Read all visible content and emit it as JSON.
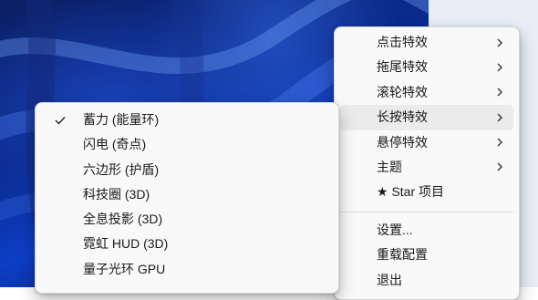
{
  "main_menu": {
    "items": [
      {
        "label": "点击特效",
        "has_submenu": true
      },
      {
        "label": "拖尾特效",
        "has_submenu": true
      },
      {
        "label": "滚轮特效",
        "has_submenu": true
      },
      {
        "label": "长按特效",
        "has_submenu": true,
        "highlighted": true
      },
      {
        "label": "悬停特效",
        "has_submenu": true
      },
      {
        "label": "主题",
        "has_submenu": true
      },
      {
        "label": "★ Star 项目",
        "has_submenu": false
      }
    ],
    "bottom_items": [
      {
        "label": "设置..."
      },
      {
        "label": "重载配置"
      },
      {
        "label": "退出"
      }
    ]
  },
  "long_press_submenu": {
    "items": [
      {
        "label": "蓄力 (能量环)",
        "checked": true
      },
      {
        "label": "闪电 (奇点)",
        "checked": false
      },
      {
        "label": "六边形 (护盾)",
        "checked": false
      },
      {
        "label": "科技圈 (3D)",
        "checked": false
      },
      {
        "label": "全息投影 (3D)",
        "checked": false
      },
      {
        "label": "霓虹 HUD (3D)",
        "checked": false
      },
      {
        "label": "量子光环 GPU",
        "checked": false
      }
    ]
  },
  "icons": {
    "submenu_arrow": "chevron-right-icon",
    "checkmark": "checkmark-icon"
  },
  "colors": {
    "menu_background": "#f9f9f9",
    "highlight": "#ebebeb",
    "text": "#1a1a1a",
    "wallpaper_primary": "#0d3ec7"
  }
}
